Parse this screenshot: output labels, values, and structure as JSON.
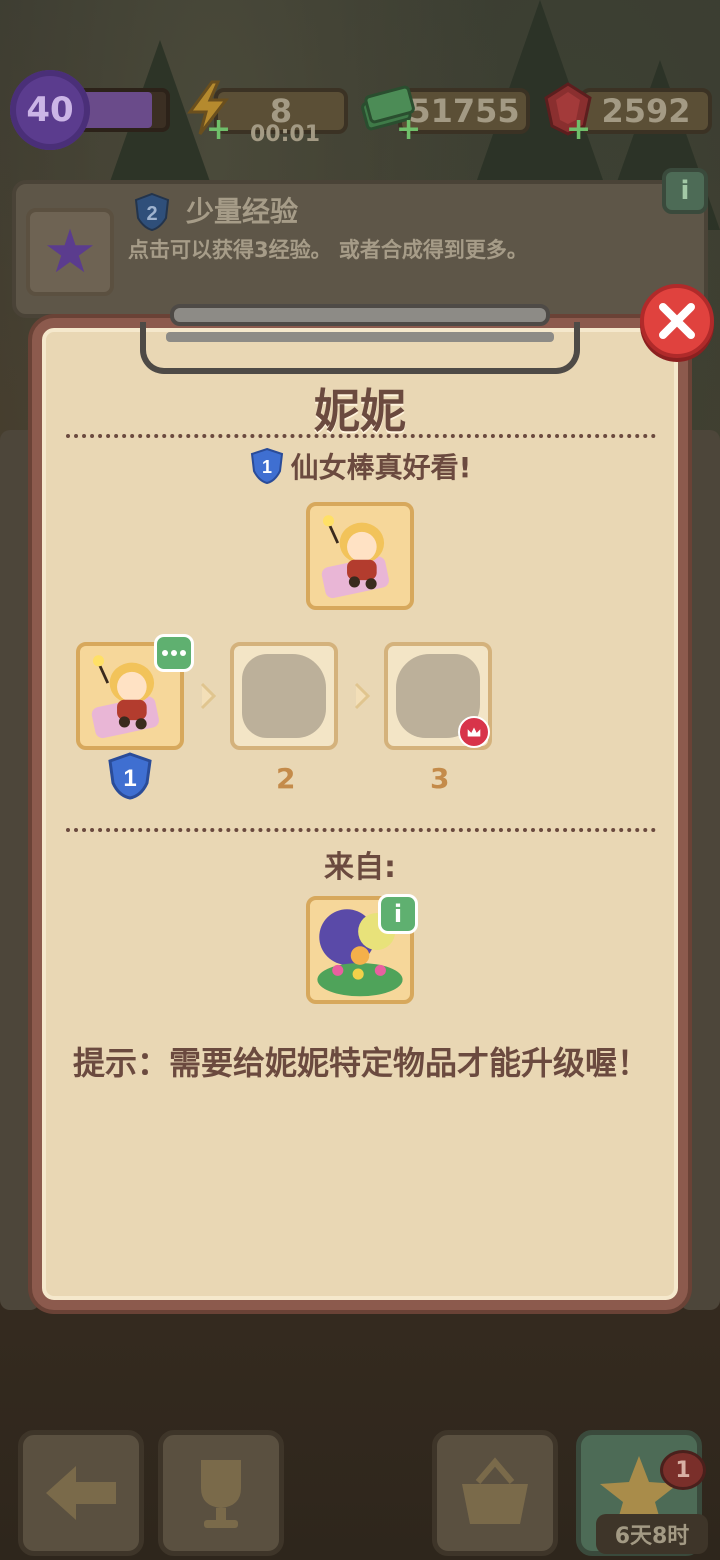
{
  "topbar": {
    "level": "40",
    "level_progress": 0.85,
    "energy": "8",
    "energy_timer": "00:01",
    "cash": "51755",
    "gems": "2592"
  },
  "info_strip": {
    "badge_level": "2",
    "title": "少量经验",
    "description": "点击可以获得3经验。 或者合成得到更多。"
  },
  "dialog": {
    "title": "妮妮",
    "subtitle_level": "1",
    "subtitle": "仙女棒真好看!",
    "evolution": [
      {
        "level": "1",
        "unlocked": true
      },
      {
        "level": "2",
        "unlocked": false
      },
      {
        "level": "3",
        "unlocked": false
      }
    ],
    "from_label": "来自:",
    "hint": "提示：需要给妮妮特定物品才能升级喔！"
  },
  "bottom": {
    "timer": "6天8时",
    "notification_count": "1"
  },
  "icons": {
    "level_badge": "purple-star-icon",
    "energy": "lightning-icon",
    "cash": "cash-stack-icon",
    "gems": "ruby-gem-icon",
    "close": "close-icon",
    "back": "back-arrow-icon",
    "trophy": "trophy-icon",
    "basket": "basket-icon",
    "star": "star-icon"
  },
  "colors": {
    "dialog_bg": "#e9d7b4",
    "dialog_border": "#8c5a4d",
    "close_red": "#e0423e",
    "text_brown": "#6b4a3f",
    "level_gold": "#c48b4a",
    "shield_blue": "#3f6fd1"
  }
}
